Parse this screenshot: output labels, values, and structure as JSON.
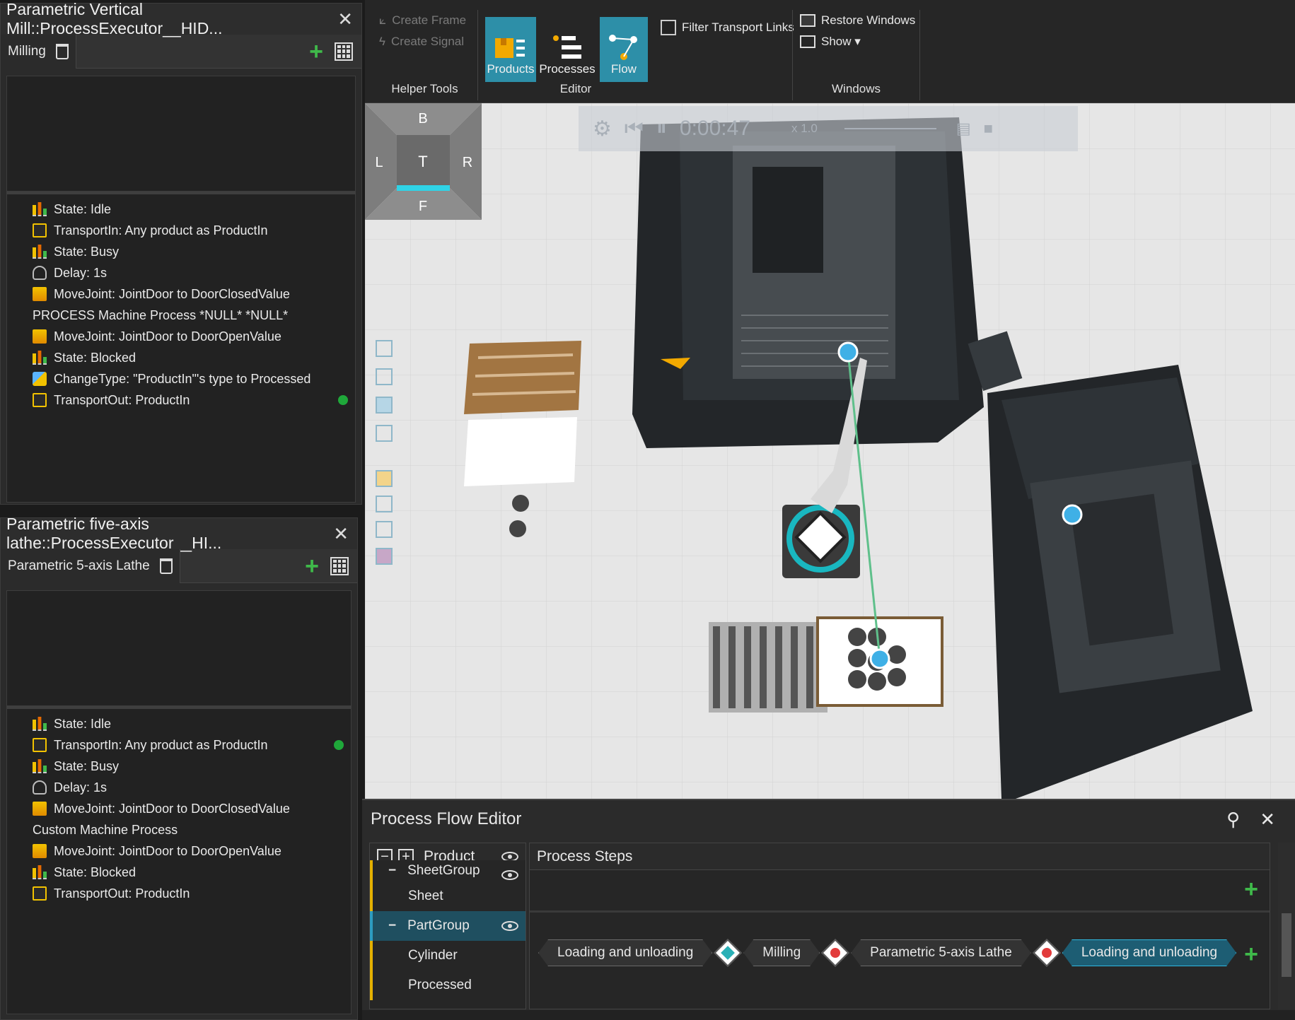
{
  "mill_panel": {
    "title": "Parametric Vertical Mill::ProcessExecutor__HID...",
    "tab_label": "Milling",
    "steps": [
      {
        "icon": "state-icon",
        "text": "State: Idle"
      },
      {
        "icon": "transport-icon",
        "text": "TransportIn: Any product as ProductIn"
      },
      {
        "icon": "state-icon",
        "text": "State: Busy"
      },
      {
        "icon": "delay-icon",
        "text": "Delay: 1s"
      },
      {
        "icon": "movejoint-icon",
        "text": "MoveJoint: JointDoor to DoorClosedValue"
      },
      {
        "icon": "",
        "text": "PROCESS Machine Process *NULL* *NULL*"
      },
      {
        "icon": "movejoint-icon",
        "text": "MoveJoint: JointDoor to DoorOpenValue"
      },
      {
        "icon": "state-icon",
        "text": "State: Blocked"
      },
      {
        "icon": "changetype-icon",
        "text": "ChangeType: \"ProductIn\"'s type to Processed"
      },
      {
        "icon": "transport-icon",
        "text": "TransportOut: ProductIn"
      }
    ]
  },
  "lathe_panel": {
    "title": "Parametric five-axis lathe::ProcessExecutor__HI...",
    "tab_label": "Parametric 5-axis Lathe",
    "steps": [
      {
        "icon": "state-icon",
        "text": "State: Idle"
      },
      {
        "icon": "transport-icon",
        "text": "TransportIn: Any product as ProductIn"
      },
      {
        "icon": "state-icon",
        "text": "State: Busy"
      },
      {
        "icon": "delay-icon",
        "text": "Delay: 1s"
      },
      {
        "icon": "movejoint-icon",
        "text": "MoveJoint: JointDoor to DoorClosedValue"
      },
      {
        "icon": "",
        "text": "Custom Machine Process"
      },
      {
        "icon": "movejoint-icon",
        "text": "MoveJoint: JointDoor to DoorOpenValue"
      },
      {
        "icon": "state-icon",
        "text": "State: Blocked"
      },
      {
        "icon": "transport-icon",
        "text": "TransportOut: ProductIn"
      }
    ]
  },
  "ribbon": {
    "create_frame": "Create Frame",
    "create_signal": "Create Signal",
    "helper_tools": "Helper Tools",
    "products": "Products",
    "processes": "Processes",
    "flow": "Flow",
    "editor": "Editor",
    "filter_transport_links": "Filter Transport Links",
    "restore_windows": "Restore Windows",
    "show": "Show ▾",
    "windows": "Windows"
  },
  "viewport": {
    "time": "0:00:47",
    "speed": "x 1.0",
    "viewcube": {
      "top": "B",
      "left": "L",
      "center": "T",
      "right": "R",
      "bottom": "F"
    }
  },
  "process_flow_editor": {
    "title": "Process Flow Editor",
    "product_header": "Product",
    "steps_header": "Process Steps",
    "tree": [
      {
        "label": "SheetGroup",
        "group": true,
        "selected": false
      },
      {
        "label": "Sheet",
        "group": false,
        "selected": false
      },
      {
        "label": "PartGroup",
        "group": true,
        "selected": true
      },
      {
        "label": "Cylinder",
        "group": false,
        "selected": false
      },
      {
        "label": "Processed",
        "group": false,
        "selected": false
      }
    ],
    "flow_chips": [
      "Loading and unloading",
      "Milling",
      "Parametric 5-axis Lathe",
      "Loading and unloading"
    ]
  },
  "colors": {
    "accent": "#2d8fa8",
    "add_green": "#3fb94a",
    "status_green": "#1fa83a"
  }
}
